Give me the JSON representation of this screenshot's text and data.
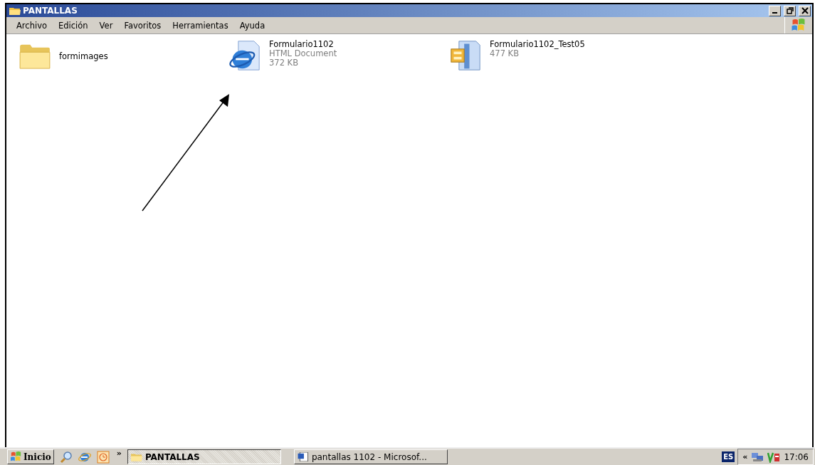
{
  "window": {
    "title": "PANTALLAS"
  },
  "menu": [
    "Archivo",
    "Edición",
    "Ver",
    "Favoritos",
    "Herramientas",
    "Ayuda"
  ],
  "files": [
    {
      "kind": "folder",
      "name": "formimages"
    },
    {
      "kind": "html",
      "name": "Formulario1102",
      "lines": [
        "HTML Document",
        "372 KB"
      ]
    },
    {
      "kind": "zip",
      "name": "Formulario1102_Test05",
      "lines": [
        "477 KB"
      ]
    }
  ],
  "taskbar": {
    "start": "Inicio",
    "more": "»",
    "tasks": [
      {
        "kind": "folder",
        "label": "PANTALLAS",
        "selected": true
      },
      {
        "kind": "word",
        "label": "pantallas 1102 - Microsof...",
        "selected": false
      }
    ],
    "language": "ES",
    "expand": "«",
    "clock": "17:06"
  }
}
